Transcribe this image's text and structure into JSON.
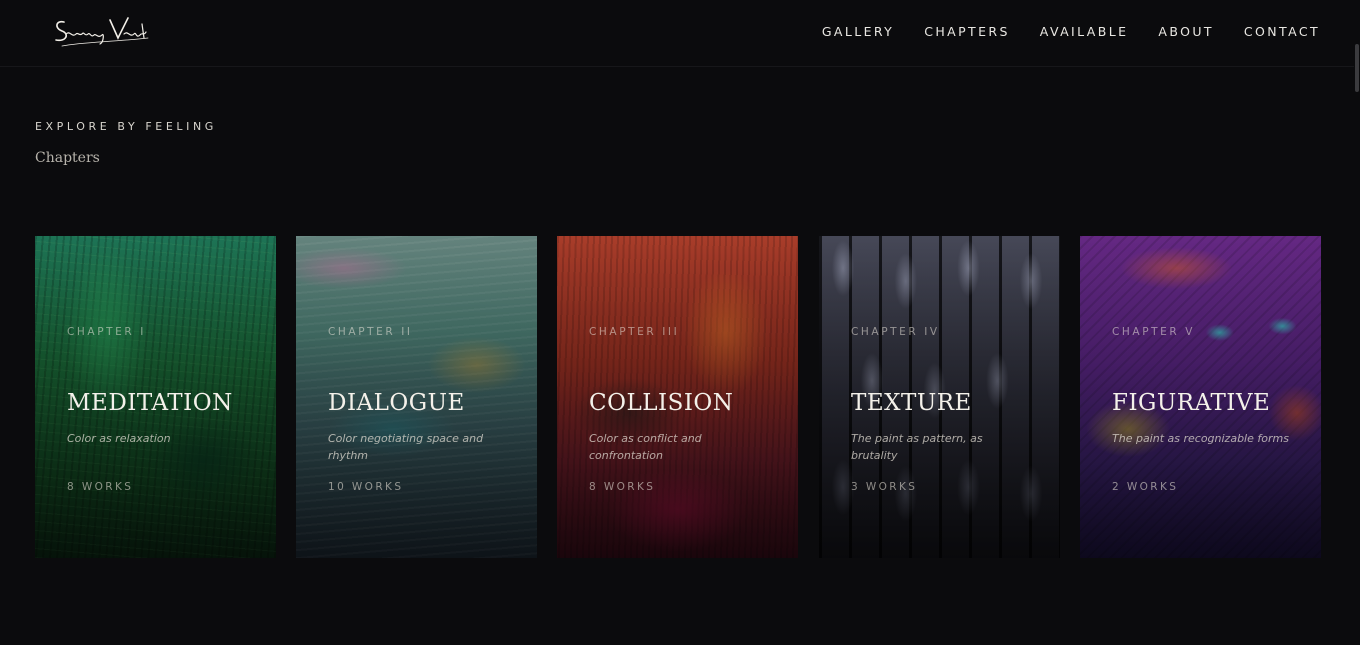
{
  "header": {
    "logo_text": "Santiago Voget",
    "nav": [
      "GALLERY",
      "CHAPTERS",
      "AVAILABLE",
      "ABOUT",
      "CONTACT"
    ]
  },
  "section": {
    "eyebrow": "EXPLORE BY FEELING",
    "title": "Chapters"
  },
  "chapters": [
    {
      "number": "CHAPTER I",
      "name": "MEDITATION",
      "description": "Color as relaxation",
      "works": "8 WORKS",
      "tone": "green"
    },
    {
      "number": "CHAPTER II",
      "name": "DIALOGUE",
      "description": "Color negotiating space and rhythm",
      "works": "10 WORKS",
      "tone": "teal"
    },
    {
      "number": "CHAPTER III",
      "name": "COLLISION",
      "description": "Color as conflict and confrontation",
      "works": "8 WORKS",
      "tone": "red"
    },
    {
      "number": "CHAPTER IV",
      "name": "TEXTURE",
      "description": "The paint as pattern, as brutality",
      "works": "3 WORKS",
      "tone": "gray"
    },
    {
      "number": "CHAPTER V",
      "name": "FIGURATIVE",
      "description": "The paint as recognizable forms",
      "works": "2 WORKS",
      "tone": "purple"
    }
  ]
}
